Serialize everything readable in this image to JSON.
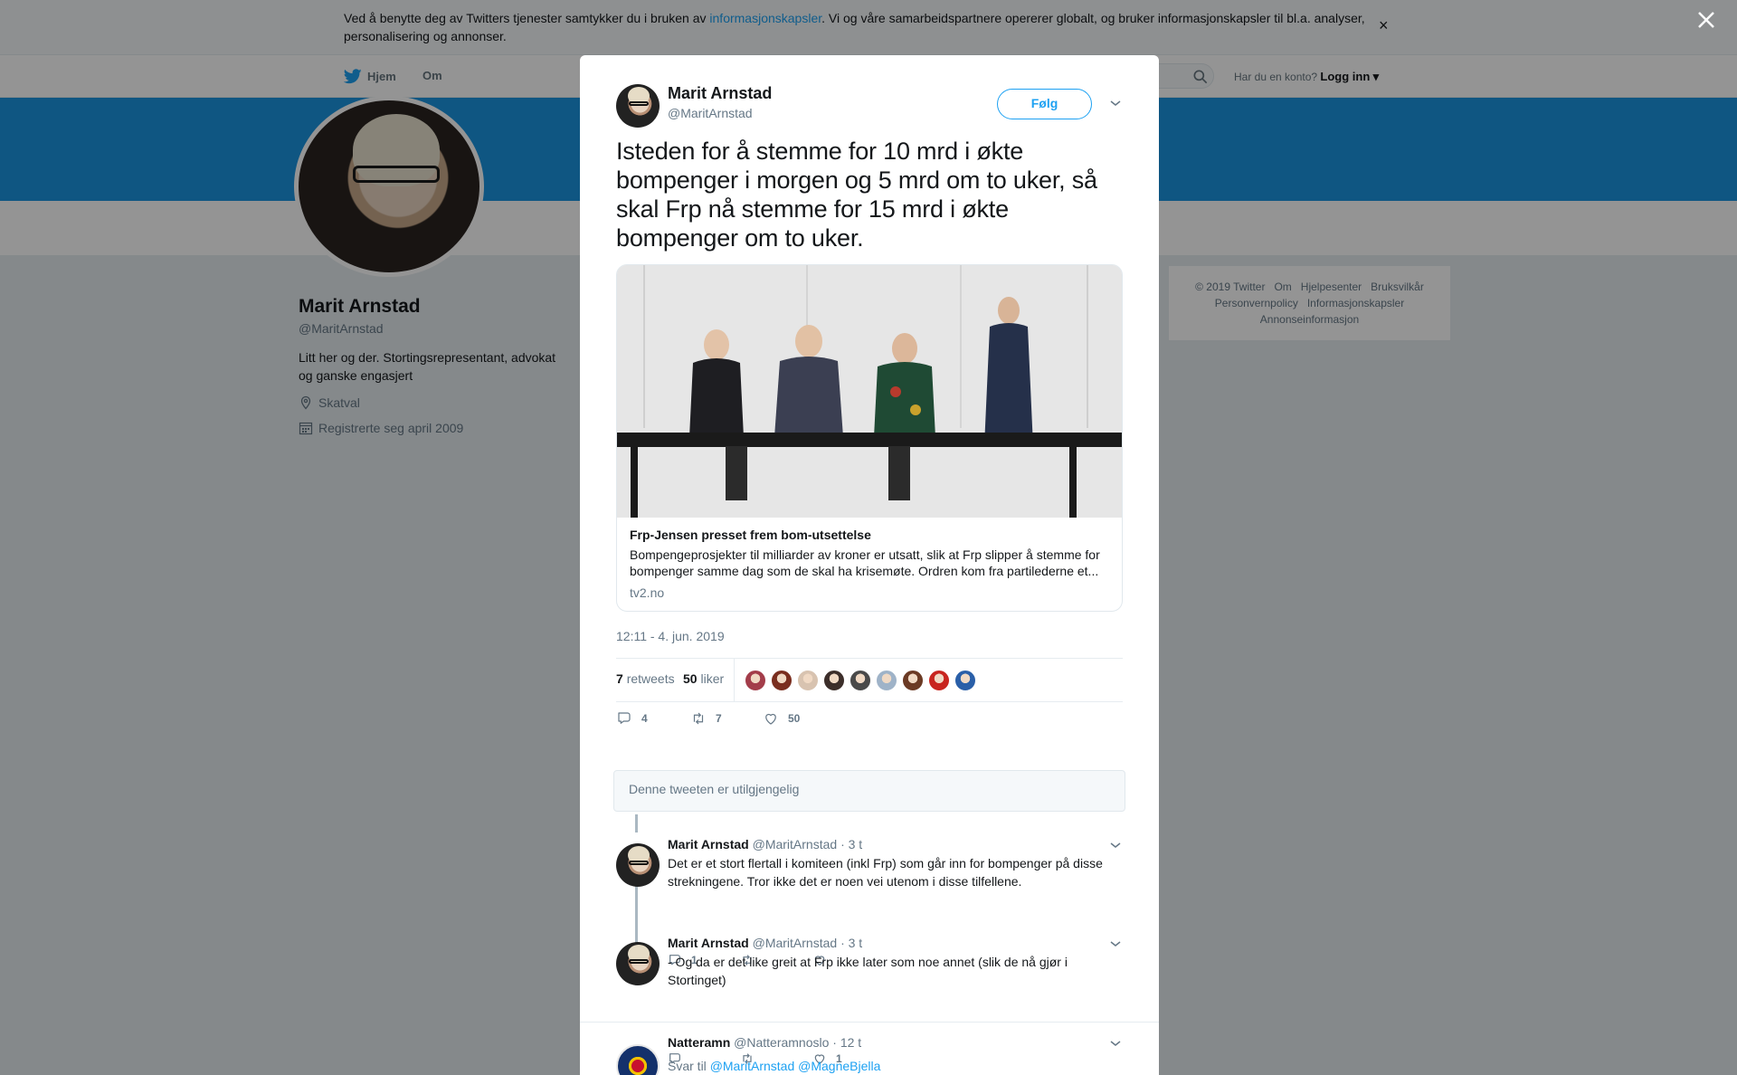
{
  "cookie": {
    "text_before": "Ved å benytte deg av Twitters tjenester samtykker du i bruken av ",
    "link": "informasjonskapsler",
    "text_after": ". Vi og våre samarbeidspartnere opererer globalt, og bruker informasjonskapsler til bl.a. analyser, personalisering og annonser.",
    "close": "×"
  },
  "topnav": {
    "home": "Hjem",
    "about": "Om",
    "has_account": "Har du en konto?",
    "login": "Logg inn",
    "login_caret": "▾"
  },
  "profile": {
    "name": "Marit Arnstad",
    "handle": "@MaritArnstad",
    "bio": "Litt her og der. Stortingsrepresentant, advokat og ganske engasjert",
    "location": "Skatval",
    "joined": "Registrerte seg april 2009"
  },
  "footer": {
    "row1": [
      "© 2019 Twitter",
      "Om",
      "Hjelpesenter",
      "Bruksvilkår"
    ],
    "row2": [
      "Personvernpolicy",
      "Informasjonskapsler"
    ],
    "row3": [
      "Annonseinformasjon"
    ]
  },
  "tweet": {
    "author_name": "Marit Arnstad",
    "author_handle": "@MaritArnstad",
    "follow_label": "Følg",
    "text": "Isteden for å stemme for 10 mrd i økte bompenger i morgen og 5 mrd om to uker, så skal Frp nå stemme for 15 mrd i økte bompenger om to uker.",
    "card": {
      "title": "Frp-Jensen presset frem bom-utsettelse",
      "description": "Bompengeprosjekter til milliarder av kroner er utsatt, slik at Frp slipper å stemme for bompenger samme dag som de skal ha krisemøte. Ordren kom fra partilederne et...",
      "domain": "tv2.no"
    },
    "timestamp": "12:11 - 4. jun. 2019",
    "retweets_count": "7",
    "retweets_label": "retweets",
    "likes_count": "50",
    "likes_label": "liker",
    "actions": {
      "replies": "4",
      "retweets": "7",
      "likes": "50"
    },
    "liker_colors": [
      "#a33d4a",
      "#7a2e1f",
      "#d8c3b0",
      "#3c2e2a",
      "#4a4a4a",
      "#9fb3c8",
      "#6b3a24",
      "#c8251f",
      "#2a5fa8"
    ]
  },
  "unavailable": "Denne tweeten er utilgjengelig",
  "replies": [
    {
      "name": "Marit Arnstad",
      "handle": "@MaritArnstad",
      "time": "· 3 t",
      "text": "Det er et stort flertall i komiteen (inkl Frp) som går inn for bompenger på disse strekningene. Tror ikke det er noen vei utenom i disse tilfellene.",
      "reply_count": "1",
      "retweet_count": "",
      "like_count": ""
    },
    {
      "name": "Marit Arnstad",
      "handle": "@MaritArnstad",
      "time": "· 3 t",
      "text": "- Og da er det like greit at Frp ikke later som noe annet (slik de nå gjør i Stortinget)",
      "reply_count": "",
      "retweet_count": "",
      "like_count": "1"
    },
    {
      "name": "Natteramn",
      "handle": "@Natteramnoslo",
      "time": "· 12 t",
      "reply_to_label": "Svar til",
      "reply_to": "@MaritArnstad @MagneBjella"
    }
  ],
  "colors": {
    "accent": "#1da1f2",
    "banner": "#1b95e0",
    "text": "#14171a",
    "muted": "#657786"
  }
}
